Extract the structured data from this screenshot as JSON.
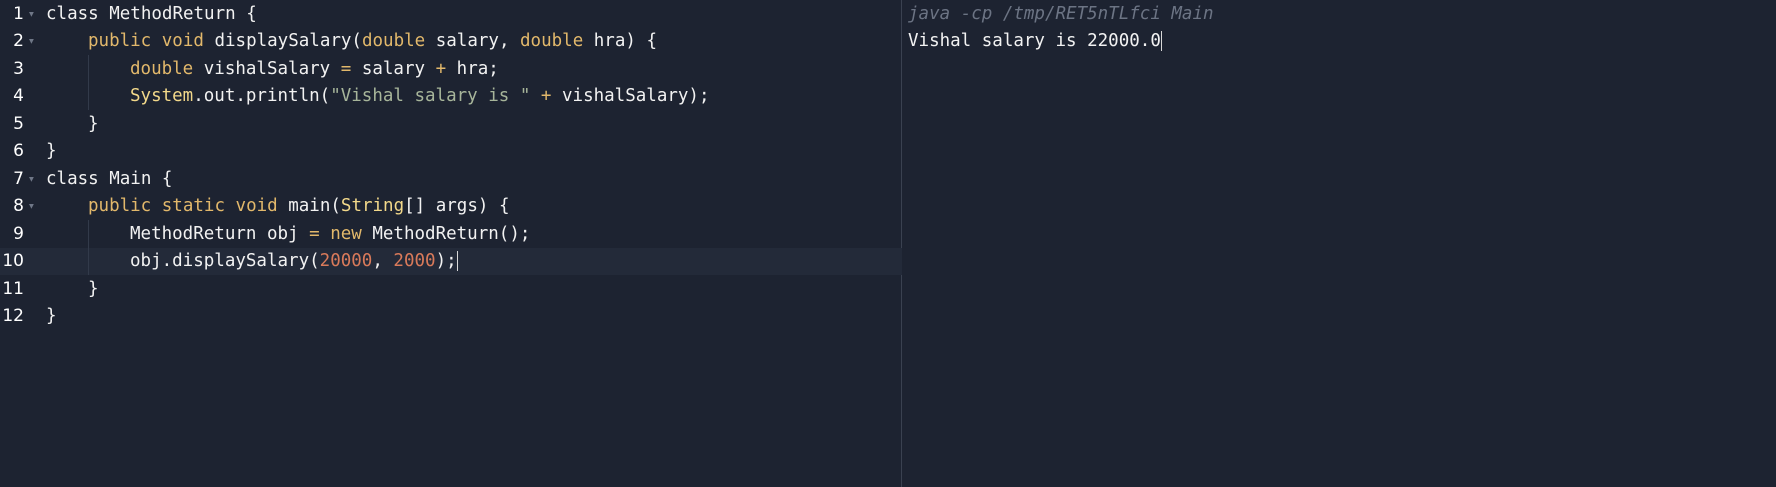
{
  "editor": {
    "lines": [
      {
        "num": "1",
        "foldable": true,
        "indent": 0,
        "tokens": [
          {
            "t": "class",
            "k": "plain"
          },
          {
            "t": " MethodReturn {",
            "k": "plain"
          }
        ]
      },
      {
        "num": "2",
        "foldable": true,
        "indent": 1,
        "tokens": [
          {
            "t": "public",
            "k": "kw"
          },
          {
            "t": " ",
            "k": "plain"
          },
          {
            "t": "void",
            "k": "kw"
          },
          {
            "t": " displaySalary(",
            "k": "plain"
          },
          {
            "t": "double",
            "k": "kw"
          },
          {
            "t": " salary, ",
            "k": "plain"
          },
          {
            "t": "double",
            "k": "kw"
          },
          {
            "t": " hra) {",
            "k": "plain"
          }
        ]
      },
      {
        "num": "3",
        "foldable": false,
        "indent": 2,
        "tokens": [
          {
            "t": "double",
            "k": "kw"
          },
          {
            "t": " vishalSalary ",
            "k": "plain"
          },
          {
            "t": "=",
            "k": "op"
          },
          {
            "t": " salary ",
            "k": "plain"
          },
          {
            "t": "+",
            "k": "op"
          },
          {
            "t": " hra;",
            "k": "plain"
          }
        ]
      },
      {
        "num": "4",
        "foldable": false,
        "indent": 2,
        "tokens": [
          {
            "t": "System",
            "k": "type"
          },
          {
            "t": ".out.println(",
            "k": "plain"
          },
          {
            "t": "\"Vishal salary is \"",
            "k": "str"
          },
          {
            "t": " ",
            "k": "plain"
          },
          {
            "t": "+",
            "k": "op"
          },
          {
            "t": " vishalSalary);",
            "k": "plain"
          }
        ]
      },
      {
        "num": "5",
        "foldable": false,
        "indent": 1,
        "tokens": [
          {
            "t": "}",
            "k": "plain"
          }
        ]
      },
      {
        "num": "6",
        "foldable": false,
        "indent": 0,
        "tokens": [
          {
            "t": "}",
            "k": "plain"
          }
        ]
      },
      {
        "num": "7",
        "foldable": true,
        "indent": 0,
        "tokens": [
          {
            "t": "class",
            "k": "plain"
          },
          {
            "t": " Main {",
            "k": "plain"
          }
        ]
      },
      {
        "num": "8",
        "foldable": true,
        "indent": 1,
        "tokens": [
          {
            "t": "public",
            "k": "kw"
          },
          {
            "t": " ",
            "k": "plain"
          },
          {
            "t": "static",
            "k": "kw"
          },
          {
            "t": " ",
            "k": "plain"
          },
          {
            "t": "void",
            "k": "kw"
          },
          {
            "t": " main(",
            "k": "plain"
          },
          {
            "t": "String",
            "k": "type"
          },
          {
            "t": "[] args) {",
            "k": "plain"
          }
        ]
      },
      {
        "num": "9",
        "foldable": false,
        "indent": 2,
        "tokens": [
          {
            "t": "MethodReturn obj ",
            "k": "plain"
          },
          {
            "t": "=",
            "k": "op"
          },
          {
            "t": " ",
            "k": "plain"
          },
          {
            "t": "new",
            "k": "kw"
          },
          {
            "t": " MethodReturn();",
            "k": "plain"
          }
        ]
      },
      {
        "num": "10",
        "foldable": false,
        "indent": 2,
        "active": true,
        "tokens": [
          {
            "t": "obj.displaySalary(",
            "k": "plain"
          },
          {
            "t": "20000",
            "k": "num"
          },
          {
            "t": ", ",
            "k": "plain"
          },
          {
            "t": "2000",
            "k": "num"
          },
          {
            "t": ");",
            "k": "plain"
          }
        ]
      },
      {
        "num": "11",
        "foldable": false,
        "indent": 1,
        "tokens": [
          {
            "t": "}",
            "k": "plain"
          }
        ]
      },
      {
        "num": "12",
        "foldable": false,
        "indent": 0,
        "tokens": [
          {
            "t": "}",
            "k": "plain"
          }
        ]
      }
    ]
  },
  "output": {
    "command": "java -cp /tmp/RET5nTLfci Main",
    "result": "Vishal salary is 22000.0"
  },
  "colors": {
    "background": "#1d2331",
    "keyword": "#e2b86b",
    "number": "#d97a5a",
    "string": "#a7b59a"
  }
}
